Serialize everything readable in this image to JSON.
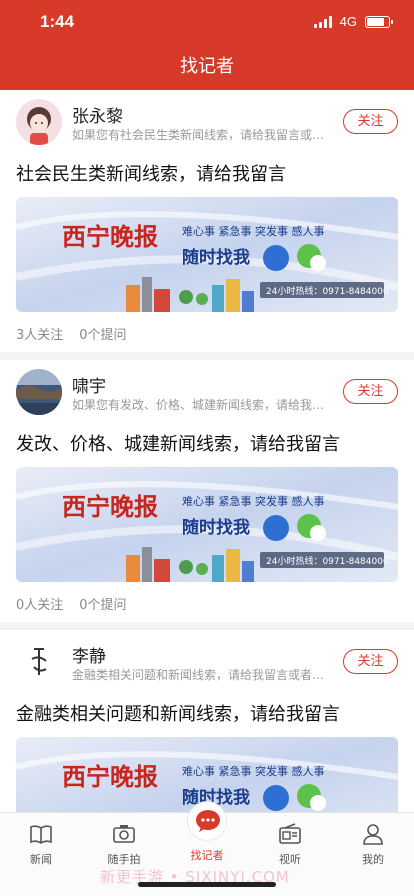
{
  "status": {
    "time": "1:44",
    "network": "4G"
  },
  "nav": {
    "title": "找记者"
  },
  "reporters": [
    {
      "name": "张永黎",
      "desc": "如果您有社会民生类新闻线索，请给我留言或…",
      "follow": "关注",
      "headline": "社会民生类新闻线索，请给我留言",
      "followers": "3人关注",
      "questions": "0个提问"
    },
    {
      "name": "啸宇",
      "desc": "如果您有发改、价格、城建新闻线索，请给我…",
      "follow": "关注",
      "headline": "发改、价格、城建新闻线索，请给我留言",
      "followers": "0人关注",
      "questions": "0个提问"
    },
    {
      "name": "李静",
      "desc": "金融类相关问题和新闻线索，请给我留言或者…",
      "follow": "关注",
      "headline": "金融类相关问题和新闻线索，请给我留言",
      "followers": "",
      "questions": ""
    }
  ],
  "banner": {
    "logo": "西宁晚报",
    "tagline": "难心事 紧急事 突发事 感人事",
    "slogan": "随时找我",
    "hotline": "24小时热线：0971-8484000"
  },
  "tabs": [
    {
      "label": "新闻",
      "icon": "news-icon"
    },
    {
      "label": "随手拍",
      "icon": "camera-icon"
    },
    {
      "label": "找记者",
      "icon": "chat-bubble-icon"
    },
    {
      "label": "视听",
      "icon": "radio-icon"
    },
    {
      "label": "我的",
      "icon": "person-icon"
    }
  ],
  "watermark": "新更手游 • SIXINYI.COM",
  "colors": {
    "brand": "#d83a2a",
    "text": "#222222",
    "muted": "#999999"
  }
}
